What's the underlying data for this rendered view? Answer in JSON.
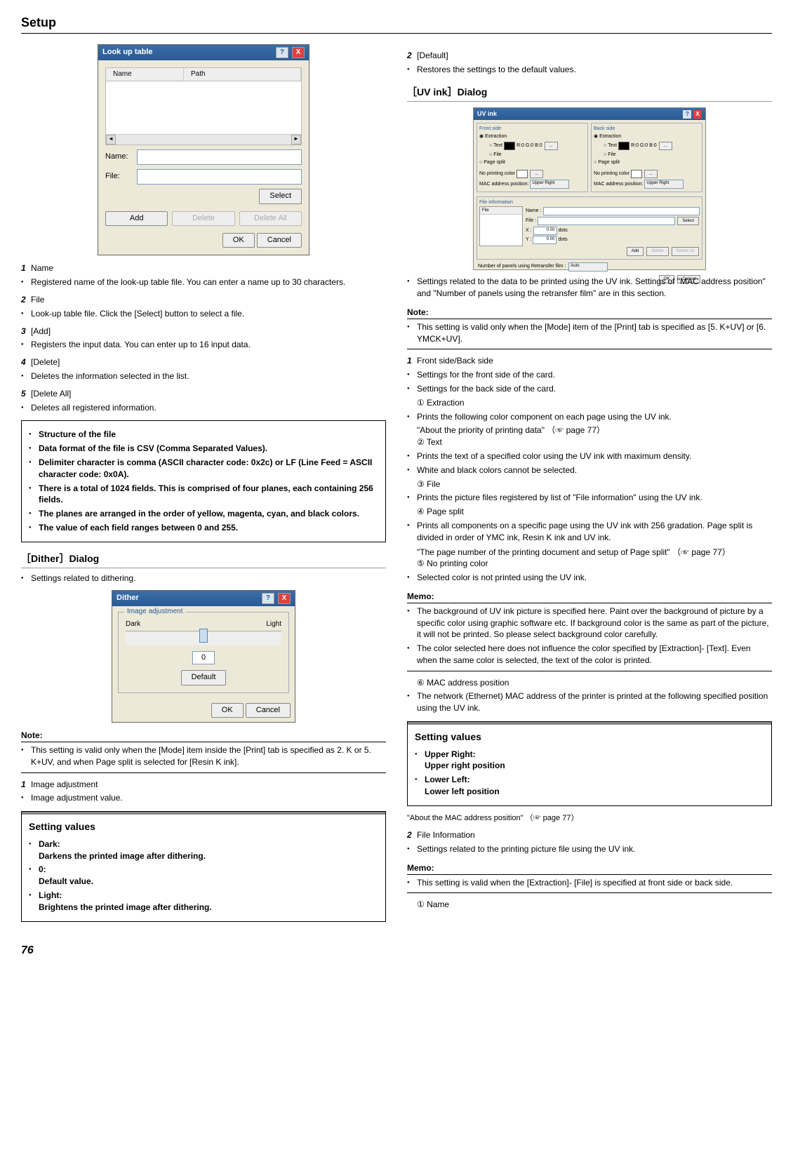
{
  "header": "Setup",
  "page": "76",
  "lookup": {
    "title": "Look up table",
    "col_name": "Name",
    "col_path": "Path",
    "lbl_name": "Name:",
    "lbl_file": "File:",
    "btn_select": "Select",
    "btn_add": "Add",
    "btn_delete": "Delete",
    "btn_delete_all": "Delete All",
    "btn_ok": "OK",
    "btn_cancel": "Cancel"
  },
  "left": {
    "i1_num": "1",
    "i1_title": "Name",
    "i1_desc": "Registered name of the look-up table file. You can enter a name up to 30 characters.",
    "i2_num": "2",
    "i2_title": "File",
    "i2_desc": "Look-up table file. Click the [Select] button to select a file.",
    "i3_num": "3",
    "i3_title": "[Add]",
    "i3_desc": "Registers the input data. You can enter up to 16 input data.",
    "i4_num": "4",
    "i4_title": "[Delete]",
    "i4_desc": "Deletes the information selected in the list.",
    "i5_num": "5",
    "i5_title": "[Delete All]",
    "i5_desc": "Deletes all registered information.",
    "box1_l1": "Structure of the file",
    "box1_l2": "Data format of the file is CSV (Comma Separated Values).",
    "box1_l3": "Delimiter character is comma (ASCII character code: 0x2c) or LF (Line Feed = ASCII character code: 0x0A).",
    "box1_l4": "There is a total of 1024 fields. This is comprised of four planes, each containing 256 fields.",
    "box1_l5": "The planes are arranged in the order of yellow, magenta, cyan, and black colors.",
    "box1_l6": "The value of each field ranges between 0 and 255.",
    "dither_title": "［Dither］Dialog",
    "dither_desc": "Settings related to dithering.",
    "dither_dlg_title": "Dither",
    "dither_legend": "Image adjustment",
    "dither_dark": "Dark",
    "dither_light": "Light",
    "dither_val": "0",
    "dither_default": "Default",
    "dither_ok": "OK",
    "dither_cancel": "Cancel",
    "note": "Note:",
    "note_txt": "This setting is valid only when the [Mode] item inside the [Print] tab is specified as 2. K or 5. K+UV, and when Page split is selected for [Resin K ink].",
    "ia_num": "1",
    "ia_title": "Image adjustment",
    "ia_desc": "Image adjustment value.",
    "sv_title": "Setting values",
    "sv_dark_l": "Dark:",
    "sv_dark_d": "Darkens the printed image after dithering.",
    "sv_zero_l": "0:",
    "sv_zero_d": "Default value.",
    "sv_light_l": "Light:",
    "sv_light_d": "Brightens the printed image after dithering."
  },
  "right": {
    "d_num": "2",
    "d_title": "[Default]",
    "d_desc": "Restores the settings to the default values.",
    "uv_title": "［UV ink］Dialog",
    "uvshot": {
      "title": "UV ink",
      "front": "Front side",
      "back": "Back side",
      "extraction": "Extraction",
      "text": "Text",
      "file": "File",
      "pagesplit": "Page split",
      "rgb1": "R:0 G:0 B:0",
      "rgb2": "R:0 G:0 B:0",
      "noprint": "No printing color",
      "mac": "MAC address position:",
      "upperright": "Upper Right",
      "fileinfo": "File information",
      "fname": "Name :",
      "ffile": "File :",
      "x": "X :",
      "y": "Y :",
      "dots": "dots",
      "fadd": "Add",
      "fdel": "Delete",
      "fdelall": "Delete All",
      "sel": "Select",
      "panels_lbl": "Number of panels using Retransfer film :",
      "auto": "Auto",
      "ok": "OK",
      "cancel": "Cancel",
      "x_val": "0.00",
      "y_val": "0.00",
      "list_file": "File"
    },
    "uv_intro": "Settings related to the data to be printed using the UV ink. Settings of \"MAC address position\" and \"Number of panels using the retransfer film\" are in this section.",
    "note": "Note:",
    "uv_note": "This setting is valid only when the [Mode] item of the [Print] tab is specified as [5. K+UV] or [6. YMCK+UV].",
    "fb_num": "1",
    "fb_title": "Front side/Back side",
    "fb_d1": "Settings for the front side of the card.",
    "fb_d2": "Settings for the back side of the card.",
    "c1": "① Extraction",
    "c1d": "Prints the following color component on each page using the UV ink.",
    "c1ref": "\"About the priority of printing data\" （☞ page 77）",
    "c2": "② Text",
    "c2d1": "Prints the text of a specified color using the UV ink with maximum density.",
    "c2d2": "White and black colors cannot be selected.",
    "c3": "③ File",
    "c3d": "Prints the picture files registered by list of \"File information\" using the UV ink.",
    "c4": "④ Page split",
    "c4d": "Prints all components on a specific page using the UV ink with 256 gradation. Page split is divided in order of YMC ink, Resin K ink and UV ink.",
    "c4ref": "\"The page number of the printing document and setup of Page split\" （☞ page 77）",
    "c5": "⑤ No printing color",
    "c5d": "Selected color is not printed using the UV ink.",
    "memo": "Memo:",
    "m1a": "The background of UV ink picture is specified here. Paint over the background of picture by a specific color using graphic software etc. If background color is the same as part of the picture, it will not be printed. So please select background color carefully.",
    "m1b": "The color selected here does not influence the color specified by [Extraction]- [Text]. Even when the same color is selected, the text of the color is printed.",
    "c6": "⑥ MAC address position",
    "c6d": "The network (Ethernet) MAC address of the printer is printed at the following specified position using the UV ink.",
    "sv_title": "Setting values",
    "sv_ur_l": "Upper Right:",
    "sv_ur_d": "Upper right position",
    "sv_ll_l": "Lower Left:",
    "sv_ll_d": "Lower left position",
    "macref": "\"About the MAC address position\" （☞ page 77）",
    "fi_num": "2",
    "fi_title": "File Information",
    "fi_desc": "Settings related to the printing picture file using the UV ink.",
    "m2": "This setting is valid when the [Extraction]- [File] is specified at front side or back side.",
    "c1b": "① Name"
  }
}
